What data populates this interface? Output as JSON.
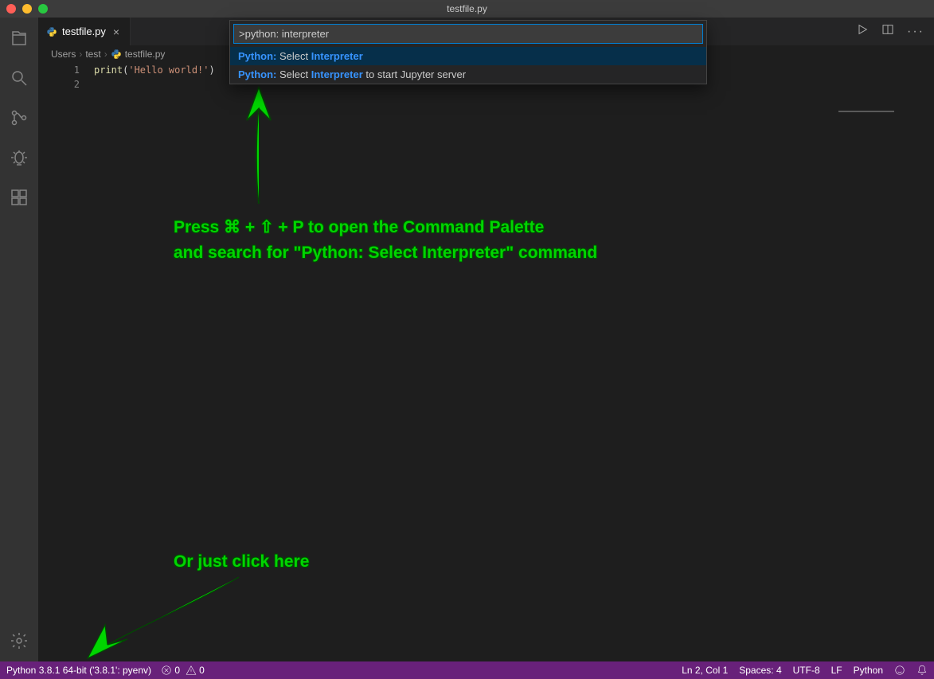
{
  "titlebar": {
    "title": "testfile.py"
  },
  "tab": {
    "filename": "testfile.py"
  },
  "breadcrumbs": {
    "p0": "Users",
    "p1": "test",
    "p2": "testfile.py"
  },
  "editor": {
    "line1_num": "1",
    "line2_num": "2",
    "line1_fn": "print",
    "line1_paren_open": "(",
    "line1_str": "'Hello world!'",
    "line1_paren_close": ")"
  },
  "palette": {
    "input_value": ">python: interpreter",
    "items": [
      {
        "hl1": "Python:",
        "rest1": " Select ",
        "hl2": "Interpreter",
        "rest2": ""
      },
      {
        "hl1": "Python:",
        "rest1": " Select ",
        "hl2": "Interpreter",
        "rest2": " to start Jupyter server"
      }
    ]
  },
  "annotation": {
    "line1": "Press ⌘ + ⇧ + P to open the Command Palette",
    "line2": "and search for \"Python: Select Interpreter\" command",
    "bottom": "Or just click here"
  },
  "statusbar": {
    "interpreter": "Python 3.8.1 64-bit ('3.8.1': pyenv)",
    "errors": "0",
    "warnings": "0",
    "cursor": "Ln 2, Col 1",
    "spaces": "Spaces: 4",
    "encoding": "UTF-8",
    "eol": "LF",
    "language": "Python"
  }
}
